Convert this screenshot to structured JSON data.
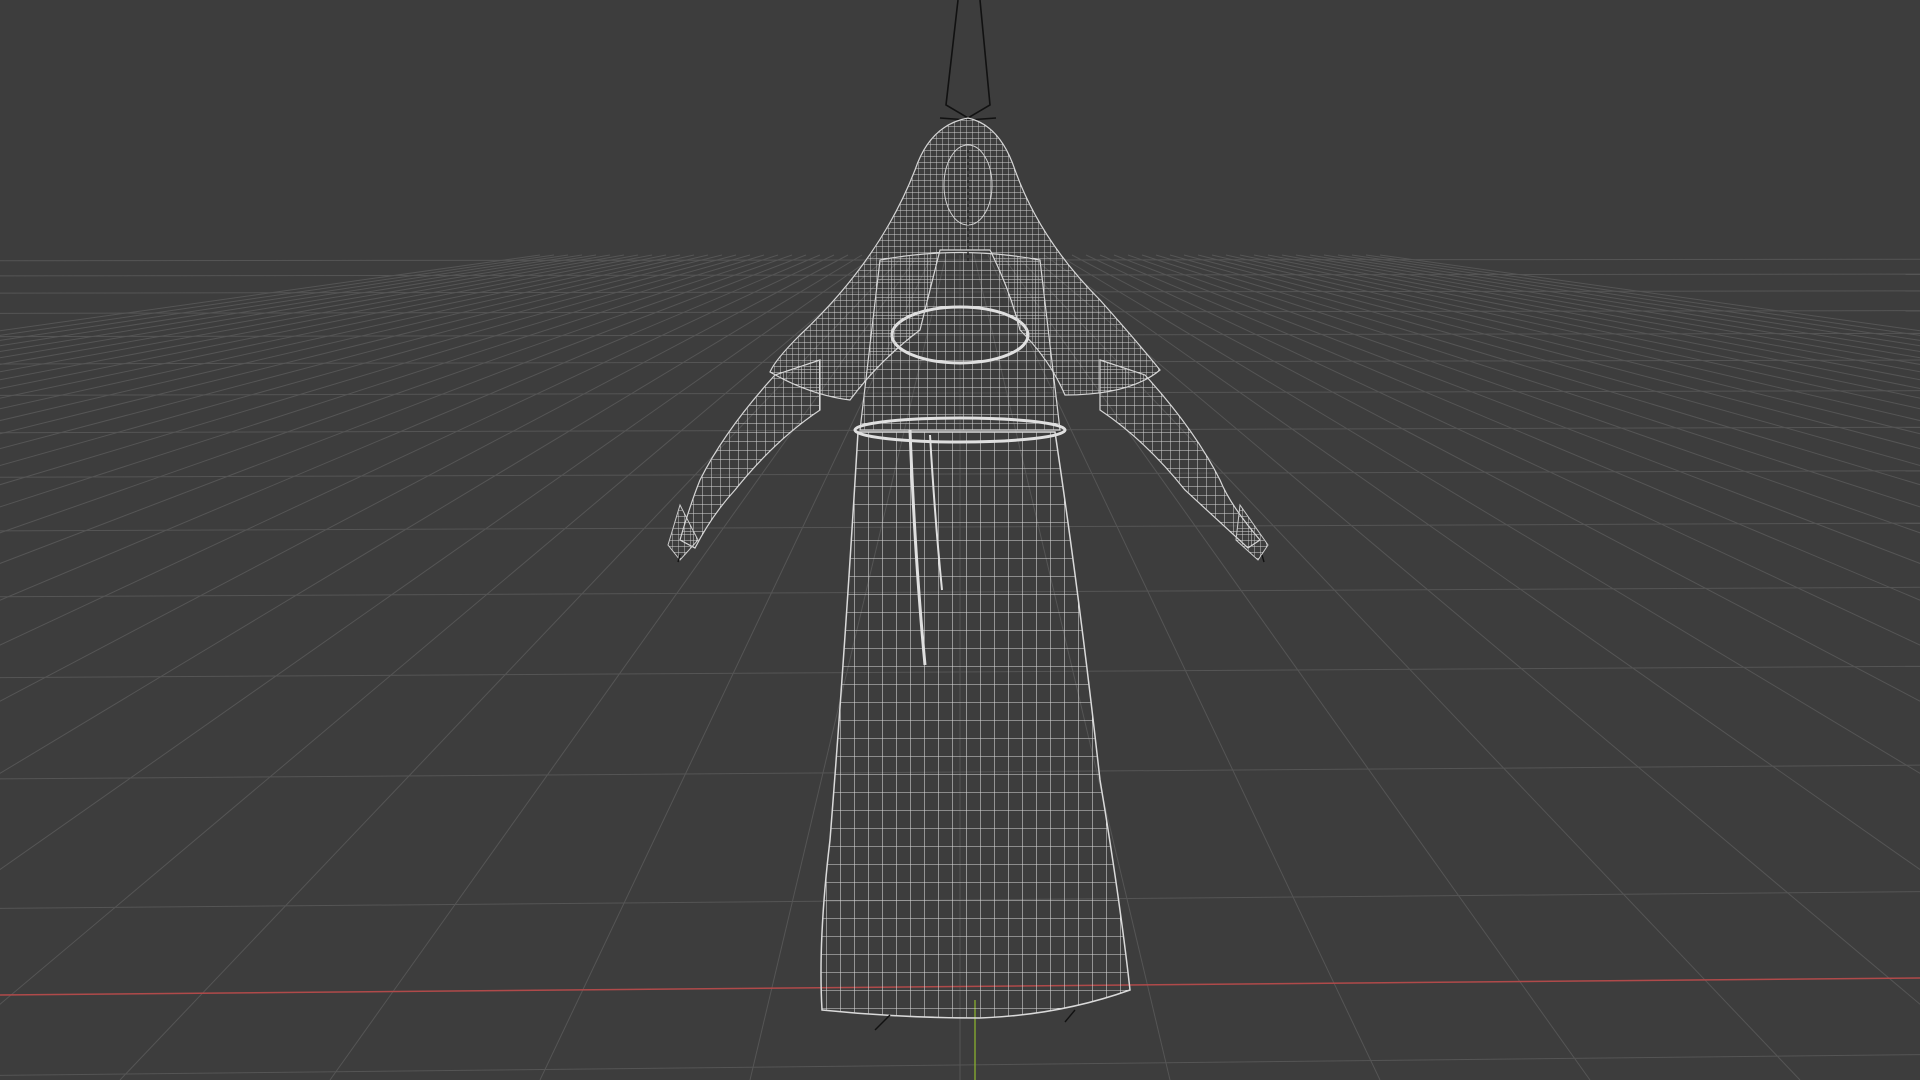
{
  "viewport": {
    "mode": "wireframe",
    "background_color": "#3d3d3d",
    "grid_color": "#555555",
    "x_axis_color": "#b04a4a",
    "y_axis_color": "#7fa030",
    "wire_color": "#d6d6d6",
    "rig_color": "#111111"
  },
  "scene": {
    "object": "robed-figure-wireframe-mesh",
    "armature": "armature-rig"
  }
}
